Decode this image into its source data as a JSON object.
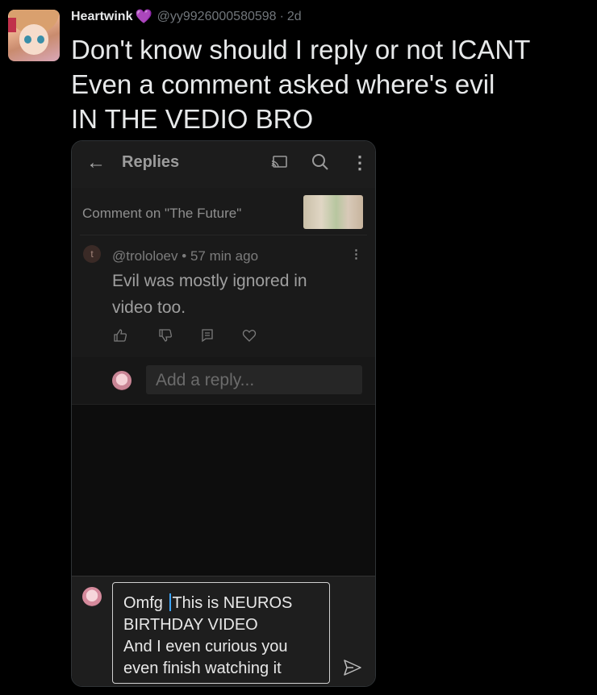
{
  "tweet": {
    "display_name": "Heartwink",
    "heart_emoji": "💜",
    "handle": "@yy9926000580598",
    "separator": "·",
    "time": "2d",
    "lines": [
      "Don't know should I reply or not ICANT",
      "Even a comment asked where's evil",
      "IN THE VEDIO BRO"
    ]
  },
  "screenshot": {
    "topbar": {
      "back_icon": "←",
      "title": "Replies",
      "more_icon": "⋮"
    },
    "comment": {
      "on_label": "Comment on \"The Future\"",
      "avatar_letter": "t",
      "author": "@trololoev",
      "meta_sep": "•",
      "age": "57 min ago",
      "more_icon": "⋮",
      "text_lines": [
        "Evil was mostly ignored in",
        "video too."
      ]
    },
    "reply_placeholder": "Add a reply...",
    "compose": {
      "text_before_cursor": "Omfg ",
      "text_after_cursor": "This is NEUROS",
      "lines": [
        "BIRTHDAY VIDEO",
        "And I even curious you",
        "even finish watching it"
      ]
    }
  },
  "colors": {
    "background": "#000000",
    "text": "#e7e9ea",
    "muted": "#71767b",
    "accent_cursor": "#3ea6ff"
  }
}
